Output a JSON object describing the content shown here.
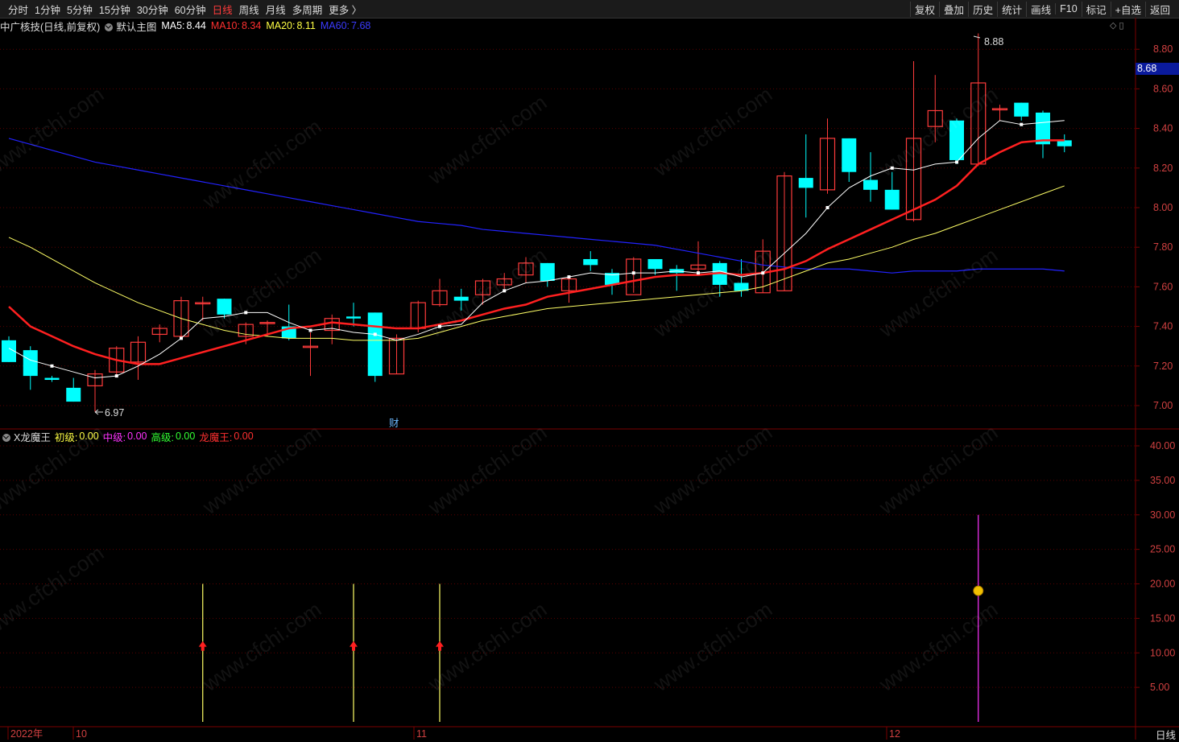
{
  "toolbar": {
    "periods": [
      "分时",
      "1分钟",
      "5分钟",
      "15分钟",
      "30分钟",
      "60分钟",
      "日线",
      "周线",
      "月线",
      "多周期",
      "更多 〉"
    ],
    "active_period": "日线",
    "right_buttons": [
      "复权",
      "叠加",
      "历史",
      "统计",
      "画线",
      "F10",
      "标记",
      "+自选",
      "返回"
    ]
  },
  "info": {
    "stock": "中广核技(日线,前复权)",
    "template": "默认主图",
    "ma5_label": "MA5:",
    "ma5": "8.44",
    "ma10_label": "MA10:",
    "ma10": "8.34",
    "ma20_label": "MA20:",
    "ma20": "8.11",
    "ma60_label": "MA60:",
    "ma60": "7.68"
  },
  "indicator": {
    "name": "X龙魔王",
    "l1_label": "初级:",
    "l1": "0.00",
    "l2_label": "中级:",
    "l2": "0.00",
    "l3_label": "高级:",
    "l3": "0.00",
    "l4_label": "龙魔王:",
    "l4": "0.00"
  },
  "price_axis": [
    "8.80",
    "8.60",
    "8.40",
    "8.20",
    "8.00",
    "7.80",
    "7.60",
    "7.40",
    "7.20",
    "7.00"
  ],
  "ind_axis": [
    "40.00",
    "35.00",
    "30.00",
    "25.00",
    "20.00",
    "15.00",
    "10.00",
    "5.00"
  ],
  "current_price": "8.68",
  "high_label": "8.88",
  "low_label": "6.97",
  "fin_marker": "财",
  "time_axis": [
    "2022年",
    "10",
    "11",
    "12"
  ],
  "bottom_period": "日线",
  "watermark": "www.cfchi.com",
  "colors": {
    "up": "#ff3b3b",
    "down": "#00ffff",
    "ma5": "#ffffff",
    "ma10": "#ff2020",
    "ma20": "#ffff66",
    "ma60": "#2222ff",
    "grid": "#3a0000"
  },
  "chart_data": {
    "type": "candlestick",
    "ylim": [
      6.9,
      8.95
    ],
    "candles": [
      [
        7.33,
        7.22,
        7.35,
        7.22
      ],
      [
        7.28,
        7.15,
        7.3,
        7.08
      ],
      [
        7.14,
        7.13,
        7.15,
        7.12
      ],
      [
        7.09,
        7.02,
        7.14,
        7.02
      ],
      [
        7.1,
        7.16,
        7.18,
        6.97
      ],
      [
        7.17,
        7.29,
        7.3,
        7.15
      ],
      [
        7.22,
        7.32,
        7.35,
        7.13
      ],
      [
        7.36,
        7.39,
        7.41,
        7.32
      ],
      [
        7.35,
        7.53,
        7.55,
        7.35
      ],
      [
        7.52,
        7.52,
        7.55,
        7.43
      ],
      [
        7.54,
        7.46,
        7.54,
        7.44
      ],
      [
        7.35,
        7.41,
        7.42,
        7.31
      ],
      [
        7.42,
        7.42,
        7.43,
        7.35
      ],
      [
        7.4,
        7.34,
        7.51,
        7.33
      ],
      [
        7.3,
        7.3,
        7.37,
        7.15
      ],
      [
        7.38,
        7.44,
        7.46,
        7.31
      ],
      [
        7.45,
        7.44,
        7.52,
        7.4
      ],
      [
        7.47,
        7.15,
        7.47,
        7.12
      ],
      [
        7.16,
        7.34,
        7.36,
        7.16
      ],
      [
        7.39,
        7.52,
        7.53,
        7.37
      ],
      [
        7.51,
        7.58,
        7.64,
        7.5
      ],
      [
        7.55,
        7.53,
        7.59,
        7.48
      ],
      [
        7.56,
        7.63,
        7.64,
        7.51
      ],
      [
        7.61,
        7.64,
        7.67,
        7.59
      ],
      [
        7.66,
        7.72,
        7.75,
        7.62
      ],
      [
        7.72,
        7.63,
        7.72,
        7.6
      ],
      [
        7.58,
        7.64,
        7.64,
        7.52
      ],
      [
        7.74,
        7.71,
        7.78,
        7.68
      ],
      [
        7.67,
        7.61,
        7.69,
        7.56
      ],
      [
        7.56,
        7.74,
        7.75,
        7.57
      ],
      [
        7.74,
        7.69,
        7.74,
        7.66
      ],
      [
        7.69,
        7.67,
        7.71,
        7.58
      ],
      [
        7.69,
        7.71,
        7.83,
        7.67
      ],
      [
        7.72,
        7.61,
        7.73,
        7.55
      ],
      [
        7.62,
        7.58,
        7.74,
        7.55
      ],
      [
        7.57,
        7.78,
        7.84,
        7.57
      ],
      [
        7.58,
        8.16,
        8.18,
        7.58
      ],
      [
        8.15,
        8.1,
        8.37,
        7.95
      ],
      [
        8.09,
        8.35,
        8.45,
        8.07
      ],
      [
        8.35,
        8.18,
        8.35,
        8.13
      ],
      [
        8.14,
        8.09,
        8.28,
        8.03
      ],
      [
        8.09,
        7.99,
        8.18,
        7.99
      ],
      [
        7.94,
        8.35,
        8.74,
        7.93
      ],
      [
        8.41,
        8.49,
        8.67,
        8.33
      ],
      [
        8.44,
        8.24,
        8.45,
        8.22
      ],
      [
        8.22,
        8.63,
        8.88,
        8.21
      ],
      [
        8.5,
        8.5,
        8.52,
        8.44
      ],
      [
        8.53,
        8.46,
        8.53,
        8.44
      ],
      [
        8.48,
        8.32,
        8.49,
        8.25
      ],
      [
        8.34,
        8.31,
        8.37,
        8.28
      ]
    ],
    "ma5": [
      7.29,
      7.23,
      7.2,
      7.17,
      7.14,
      7.15,
      7.2,
      7.26,
      7.34,
      7.44,
      7.45,
      7.47,
      7.47,
      7.42,
      7.38,
      7.39,
      7.37,
      7.36,
      7.33,
      7.36,
      7.4,
      7.41,
      7.52,
      7.58,
      7.62,
      7.63,
      7.65,
      7.67,
      7.66,
      7.67,
      7.67,
      7.68,
      7.67,
      7.68,
      7.65,
      7.67,
      7.77,
      7.87,
      8.0,
      8.1,
      8.16,
      8.2,
      8.19,
      8.22,
      8.23,
      8.35,
      8.44,
      8.42,
      8.43,
      8.44
    ],
    "ma10": [
      7.5,
      7.4,
      7.35,
      7.3,
      7.26,
      7.23,
      7.21,
      7.21,
      7.24,
      7.27,
      7.3,
      7.33,
      7.36,
      7.39,
      7.4,
      7.42,
      7.41,
      7.4,
      7.39,
      7.39,
      7.41,
      7.43,
      7.46,
      7.49,
      7.51,
      7.55,
      7.57,
      7.59,
      7.61,
      7.63,
      7.65,
      7.66,
      7.66,
      7.67,
      7.66,
      7.67,
      7.69,
      7.73,
      7.79,
      7.84,
      7.89,
      7.94,
      7.99,
      8.04,
      8.11,
      8.22,
      8.28,
      8.33,
      8.34,
      8.34
    ],
    "ma20": [
      7.85,
      7.8,
      7.74,
      7.68,
      7.62,
      7.57,
      7.52,
      7.48,
      7.44,
      7.41,
      7.38,
      7.36,
      7.35,
      7.34,
      7.34,
      7.34,
      7.33,
      7.33,
      7.33,
      7.34,
      7.37,
      7.4,
      7.43,
      7.45,
      7.47,
      7.49,
      7.5,
      7.51,
      7.52,
      7.53,
      7.54,
      7.55,
      7.56,
      7.57,
      7.58,
      7.6,
      7.64,
      7.68,
      7.72,
      7.74,
      7.77,
      7.8,
      7.84,
      7.87,
      7.91,
      7.95,
      7.99,
      8.03,
      8.07,
      8.11
    ],
    "ma60": [
      8.35,
      8.32,
      8.29,
      8.26,
      8.23,
      8.21,
      8.19,
      8.17,
      8.15,
      8.13,
      8.11,
      8.09,
      8.07,
      8.05,
      8.03,
      8.01,
      7.99,
      7.97,
      7.95,
      7.93,
      7.92,
      7.91,
      7.89,
      7.88,
      7.87,
      7.86,
      7.85,
      7.84,
      7.83,
      7.82,
      7.81,
      7.79,
      7.77,
      7.75,
      7.73,
      7.71,
      7.7,
      7.69,
      7.69,
      7.69,
      7.68,
      7.67,
      7.68,
      7.68,
      7.68,
      7.69,
      7.69,
      7.69,
      7.69,
      7.68
    ],
    "signals": [
      {
        "index": 9,
        "type": "yellow-line",
        "top": 20,
        "arrow": 11
      },
      {
        "index": 16,
        "type": "yellow-line",
        "top": 20,
        "arrow": 11
      },
      {
        "index": 20,
        "type": "yellow-line",
        "top": 20,
        "arrow": 11
      },
      {
        "index": 45,
        "type": "magenta-line",
        "top": 30,
        "coin": 19
      }
    ],
    "ind_ylim": [
      0,
      43
    ]
  }
}
